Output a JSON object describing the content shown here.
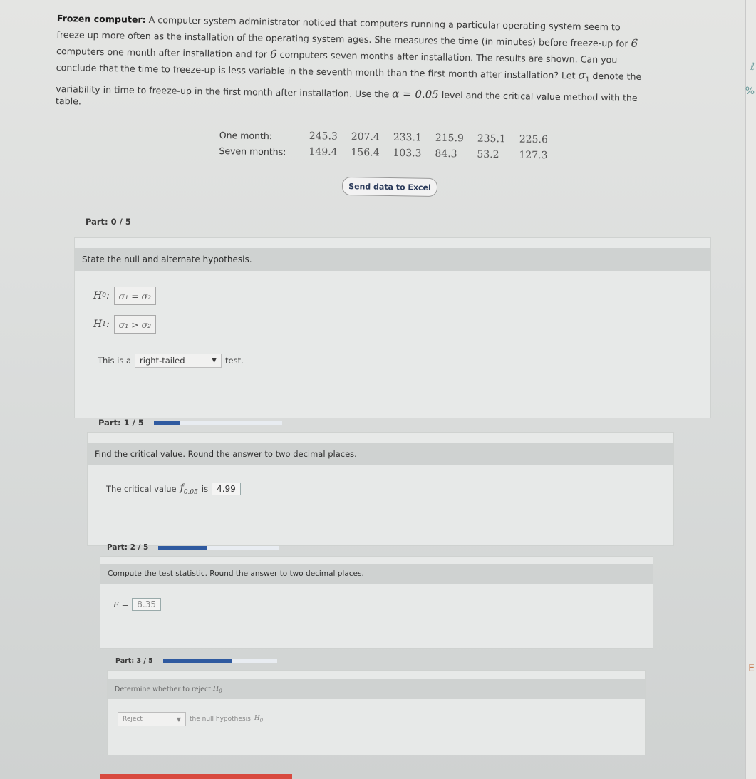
{
  "problem": {
    "title": "Frozen computer:",
    "line1": "A computer system administrator noticed that computers running a particular operating system seem to",
    "line2": "freeze up more often as the installation of the operating system ages. She measures the time (in minutes) before freeze-up for",
    "n1": "6",
    "line3": "computers one month after installation and for",
    "n2": "6",
    "line3b": "computers seven months after installation. The results are shown. Can you",
    "line4": "conclude that the time to freeze-up is less variable in the seventh month than the first month after installation? Let",
    "sigma1": "σ",
    "line4b": "denote the",
    "line5": "variability in time to freeze-up in the first month after installation. Use the",
    "alpha": "α = 0.05",
    "line5b": "level and the critical value method with the",
    "line6": "table."
  },
  "table": {
    "rows": [
      {
        "label": "One month:",
        "values": [
          "245.3",
          "207.4",
          "233.1",
          "215.9",
          "235.1",
          "225.6"
        ]
      },
      {
        "label": "Seven months:",
        "values": [
          "149.4",
          "156.4",
          "103.3",
          "84.3",
          "53.2",
          "127.3"
        ]
      }
    ]
  },
  "excel_button": "Send data to Excel",
  "parts": [
    {
      "label": "Part:",
      "fraction": "0 / 5",
      "progress": 0
    },
    {
      "label": "Part:",
      "fraction": "1 / 5",
      "progress": 0.2
    },
    {
      "label": "Part:",
      "fraction": "2 / 5",
      "progress": 0.4
    },
    {
      "label": "Part:",
      "fraction": "3 / 5",
      "progress": 0.6
    }
  ],
  "q0": {
    "prompt": "State the null and alternate hypothesis.",
    "h0_label": "H",
    "h0_sub": "0",
    "h0_value": "σ₁ = σ₂",
    "h1_label": "H",
    "h1_sub": "1",
    "h1_value": "σ₁ > σ₂",
    "tail_prefix": "This is a",
    "tail_value": "right-tailed",
    "tail_suffix": "test."
  },
  "q1": {
    "prompt": "Find the critical value. Round the answer to two decimal places.",
    "text": "The critical value",
    "f_symbol": "f",
    "f_sub": "0.05",
    "is": "is",
    "value": "4.99"
  },
  "q2": {
    "prompt": "Compute the test statistic. Round the answer to two decimal places.",
    "label": "F =",
    "value": "8.35"
  },
  "q3": {
    "prompt": "Determine whether to reject",
    "h0": "H",
    "h0_sub": "0",
    "decision": "Reject",
    "suffix": "the null hypothesis",
    "suffix_h0": "H",
    "suffix_h0_sub": "0"
  },
  "colors": {
    "progress": "#2f5aa0",
    "red_bar": "#d84a3f"
  }
}
